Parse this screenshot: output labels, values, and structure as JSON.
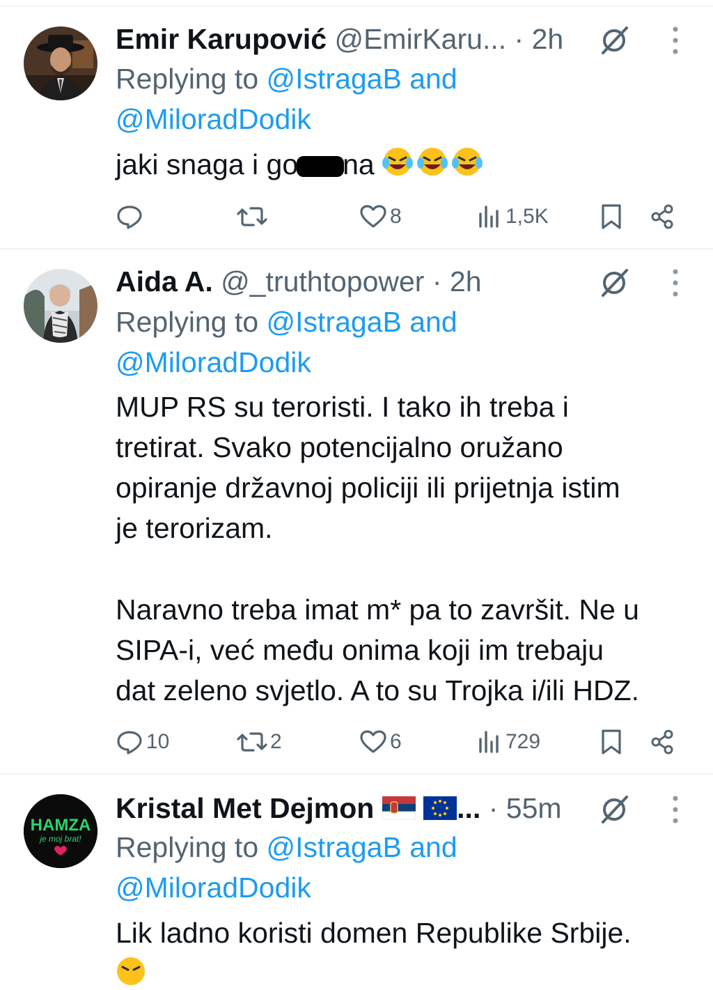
{
  "tweets": [
    {
      "name": "Emir Karupović",
      "handle": "@EmirKaru...",
      "sep": " · ",
      "time": "2h",
      "replying_prefix": "Replying to ",
      "replying_to_1": "@IstragaB",
      "replying_and": " and",
      "replying_to_2": "@MiloradDodik",
      "text_before_redaction": "jaki snaga i go",
      "text_after_redaction": "na",
      "reply_count": "",
      "repost_count": "",
      "like_count": "8",
      "view_count": "1,5K"
    },
    {
      "name": "Aida A.",
      "handle": "@_truthtopower",
      "sep": " · ",
      "time": "2h",
      "replying_prefix": "Replying to ",
      "replying_to_1": "@IstragaB",
      "replying_and": " and",
      "replying_to_2": "@MiloradDodik",
      "lines": [
        "MUP RS su teroristi. I tako ih treba i",
        "tretirat. Svako potencijalno oružano",
        "opiranje državnoj policiji ili prijetnja istim",
        "je terorizam.",
        "Naravno treba imat m* pa to završit. Ne u",
        "SIPA-i, već među onima koji im trebaju",
        "dat zeleno svjetlo. A to su Trojka i/ili HDZ."
      ],
      "reply_count": "10",
      "repost_count": "2",
      "like_count": "6",
      "view_count": "729"
    },
    {
      "name": "Kristal Met Dejmon",
      "name_suffix": "...",
      "handle": "",
      "sep": " · ",
      "time": "55m",
      "replying_prefix": "Replying to ",
      "replying_to_1": "@IstragaB",
      "replying_and": " and",
      "replying_to_2": "@MiloradDodik",
      "text": "Lik ladno koristi domen Republike Srbije.",
      "avatar_text_1": "HAMZA",
      "avatar_text_2": "je moj brat!"
    }
  ],
  "icons": [
    "grok-icon",
    "more-icon",
    "reply-icon",
    "repost-icon",
    "like-icon",
    "views-icon",
    "bookmark-icon",
    "share-icon"
  ],
  "colors": {
    "text": "#0f1419",
    "secondary": "#536471",
    "link": "#1d9bf0",
    "divider": "#eff3f4"
  }
}
